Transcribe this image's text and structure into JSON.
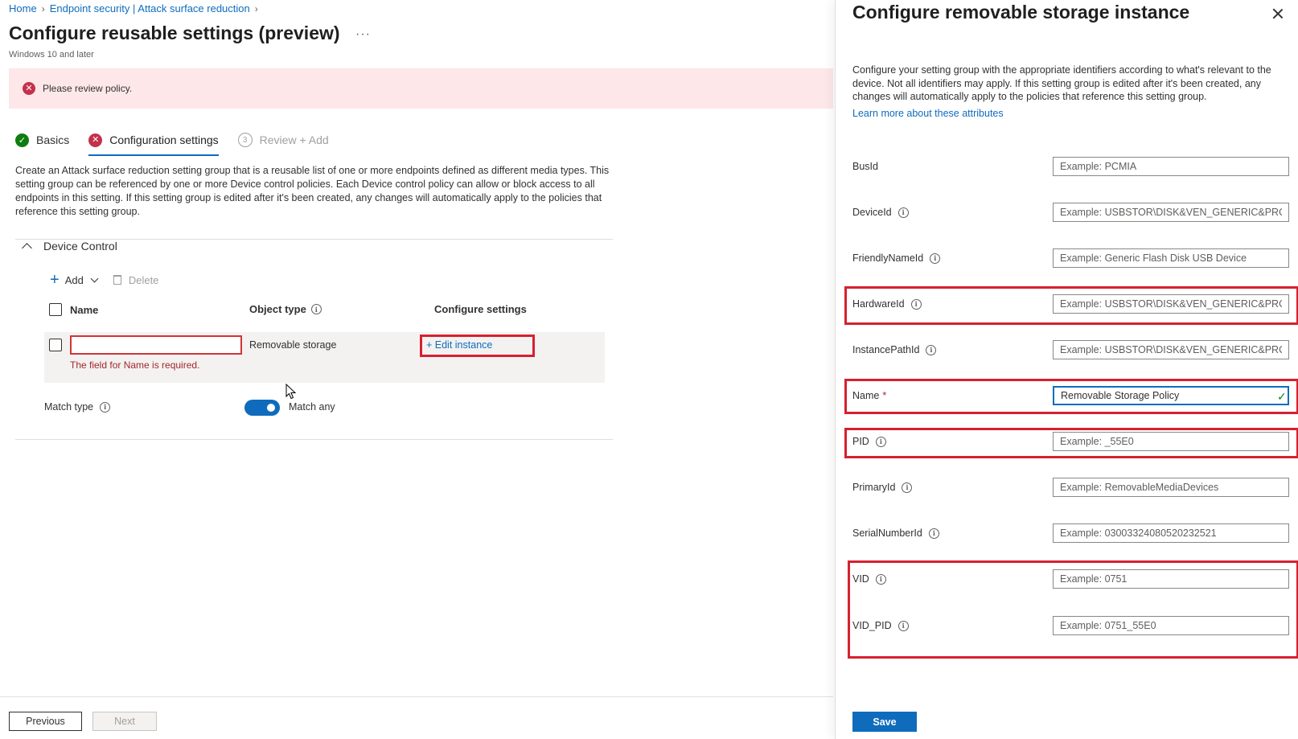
{
  "breadcrumb": [
    {
      "label": "Home"
    },
    {
      "label": "Endpoint security | Attack surface reduction"
    }
  ],
  "page": {
    "title": "Configure reusable settings (preview)",
    "more": "···",
    "subtitle": "Windows 10 and later"
  },
  "error_banner": {
    "text": "Please review policy."
  },
  "wizard": [
    {
      "label": "Basics",
      "status": "complete"
    },
    {
      "label": "Configuration settings",
      "status": "error"
    },
    {
      "number": "3",
      "label": "Review + Add",
      "status": "disabled"
    }
  ],
  "description": "Create an Attack surface reduction setting group that is a reusable list of one or more endpoints defined as different media types. This setting group can be referenced by one or more Device control policies. Each Device control policy can allow or block access to all endpoints in this setting. If this setting group is edited after it's been created, any changes will automatically apply to the policies that reference this setting group.",
  "section": {
    "title": "Device Control"
  },
  "toolbar": {
    "add": "Add",
    "delete": "Delete"
  },
  "table": {
    "columns": [
      "Name",
      "Object type",
      "Configure settings"
    ],
    "row": {
      "name_value": "",
      "name_error": "The field for Name is required.",
      "object_type": "Removable storage",
      "action": "+ Edit instance"
    }
  },
  "match": {
    "label": "Match type",
    "toggle_label": "Match any",
    "on": true
  },
  "footer": {
    "previous": "Previous",
    "next": "Next"
  },
  "panel": {
    "title": "Configure removable storage instance",
    "description": "Configure your setting group with the appropriate identifiers according to what's relevant to the device. Not all identifiers may apply. If this setting group is edited after it's been created, any changes will automatically apply to the policies that reference this setting group.",
    "link": "Learn more about these attributes",
    "fields": [
      {
        "label": "BusId",
        "placeholder": "Example: PCMIA",
        "value": "",
        "info": false
      },
      {
        "label": "DeviceId",
        "placeholder": "Example: USBSTOR\\DISK&VEN_GENERIC&PRO...",
        "value": "",
        "info": true
      },
      {
        "label": "FriendlyNameId",
        "placeholder": "Example: Generic Flash Disk USB Device",
        "value": "",
        "info": true
      },
      {
        "label": "HardwareId",
        "placeholder": "Example: USBSTOR\\DISK&VEN_GENERIC&PRO...",
        "value": "",
        "info": true
      },
      {
        "label": "InstancePathId",
        "placeholder": "Example: USBSTOR\\DISK&VEN_GENERIC&PRO...",
        "value": "",
        "info": true
      },
      {
        "label": "Name",
        "placeholder": "",
        "value": "Removable Storage Policy",
        "required": "*",
        "info": false
      },
      {
        "label": "PID",
        "placeholder": "Example: _55E0",
        "value": "",
        "info": true
      },
      {
        "label": "PrimaryId",
        "placeholder": "Example: RemovableMediaDevices",
        "value": "",
        "info": true
      },
      {
        "label": "SerialNumberId",
        "placeholder": "Example: 03003324080520232521",
        "value": "",
        "info": true
      },
      {
        "label": "VID",
        "placeholder": "Example: 0751",
        "value": "",
        "info": true
      },
      {
        "label": "VID_PID",
        "placeholder": "Example: 0751_55E0",
        "value": "",
        "info": true
      }
    ],
    "save": "Save"
  },
  "colors": {
    "accent": "#0f6cbd",
    "error": "#c4314b",
    "highlight": "#d6202f",
    "success": "#107c10"
  }
}
